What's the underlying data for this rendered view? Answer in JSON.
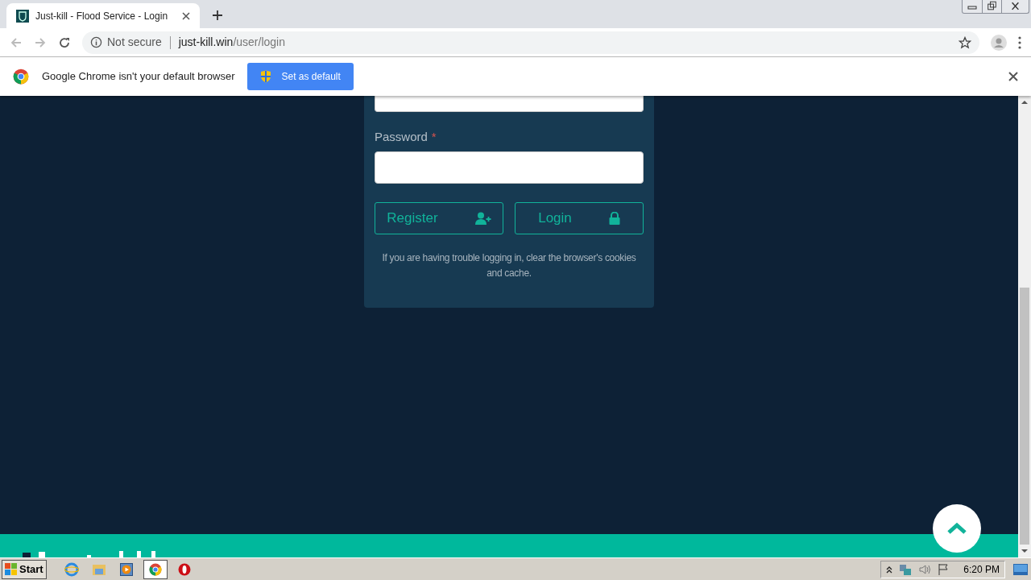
{
  "browser": {
    "tab": {
      "title": "Just-kill - Flood Service - Login",
      "selected": true
    },
    "security": "Not secure",
    "url_host": "just-kill.win",
    "url_path": "/user/login"
  },
  "infobar": {
    "message": "Google Chrome isn't your default browser",
    "button": "Set as default"
  },
  "form": {
    "password_label": "Password",
    "required_mark": "*",
    "buttons": [
      {
        "label": "Register",
        "kind": "register"
      },
      {
        "label": "Login",
        "kind": "login"
      }
    ],
    "note": "If you are having trouble logging in, clear the browser's cookies and cache."
  },
  "taskbar": {
    "start": "Start",
    "apps": [
      {
        "kind": "ie",
        "selected": false
      },
      {
        "kind": "folder",
        "selected": false
      },
      {
        "kind": "media",
        "selected": false
      },
      {
        "kind": "chrome",
        "selected": true
      },
      {
        "kind": "opera",
        "selected": false
      }
    ],
    "clock": "6:20 PM"
  }
}
